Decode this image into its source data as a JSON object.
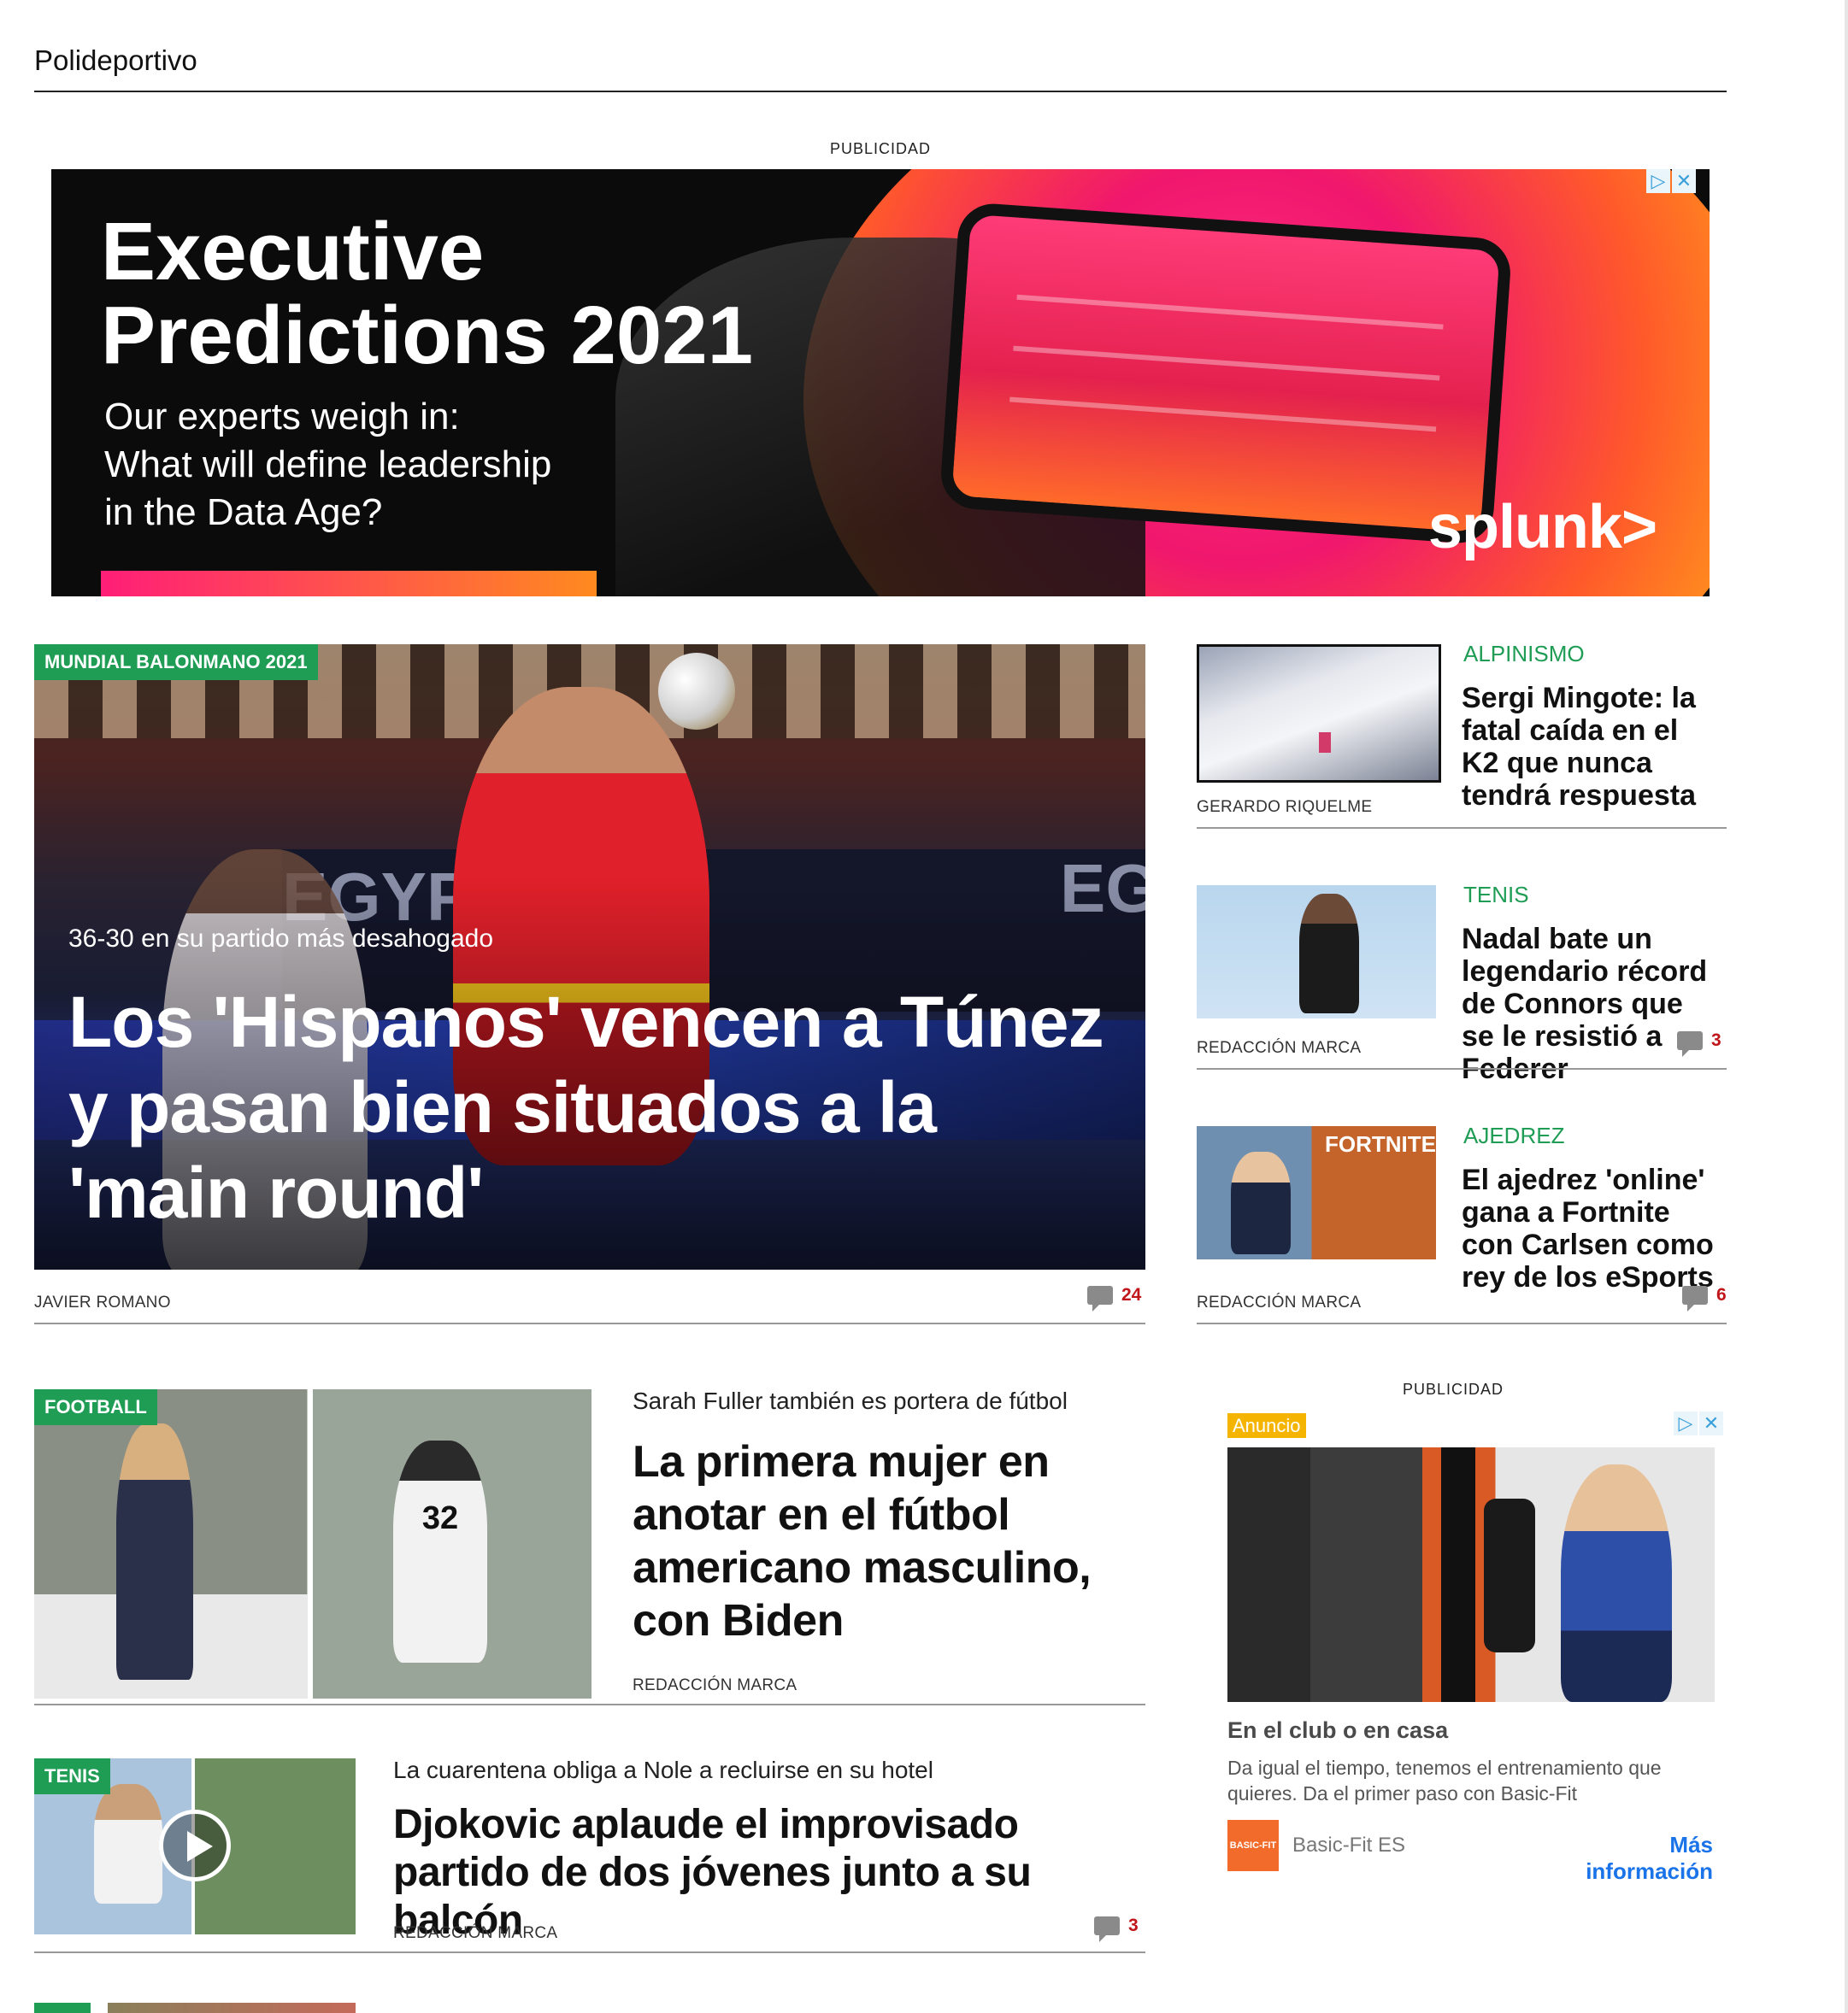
{
  "section": {
    "title": "Polideportivo"
  },
  "ads": {
    "label": "PUBLICIDAD",
    "top": {
      "headline_line1": "Executive",
      "headline_line2": "Predictions 2021",
      "sub_line1": "Our experts weigh in:",
      "sub_line2": "What will define leadership",
      "sub_line3": "in the Data Age?",
      "brand": "splunk>"
    },
    "sidebar": {
      "badge": "Anuncio",
      "title": "En el club o en casa",
      "body": "Da igual el tiempo, tenemos el entrenamiento que quieres. Da el primer paso con Basic-Fit",
      "logo_text": "BASIC-FIT",
      "source": "Basic-Fit ES",
      "cta": "Más información"
    }
  },
  "hero": {
    "tag": "MUNDIAL BALONMANO 2021",
    "kicker": "36-30 en su partido más desahogado",
    "title": "Los 'Hispanos' vencen a Túnez y pasan bien situados a la 'main round'",
    "author": "JAVIER ROMANO",
    "comments": "24",
    "photo_text_left": "EGYPT",
    "photo_text_right": "EGY"
  },
  "sidebar_stories": [
    {
      "category": "ALPINISMO",
      "title": "Sergi Mingote: la fatal caída en el K2 que nunca tendrá respuesta",
      "author": "GERARDO RIQUELME",
      "comments": ""
    },
    {
      "category": "TENIS",
      "title": "Nadal bate un legendario récord de Connors que se le resistió a Federer",
      "author": "REDACCIÓN MARCA",
      "comments": "3"
    },
    {
      "category": "AJEDREZ",
      "title": "El ajedrez 'online' gana a Fortnite con Carlsen como rey de los eSports",
      "author": "REDACCIÓN MARCA",
      "comments": "6",
      "thumb_text": "FORTNITE"
    }
  ],
  "stories": [
    {
      "tag": "FOOTBALL",
      "kicker": "Sarah Fuller también es portera de fútbol",
      "title": "La primera mujer en anotar en el fútbol americano masculino, con Biden",
      "author": "REDACCIÓN MARCA",
      "comments": "",
      "jersey": "32"
    },
    {
      "tag": "TENIS",
      "kicker": "La cuarentena obliga a Nole a recluirse en su hotel",
      "title": "Djokovic aplaude el improvisado partido de dos jóvenes junto a su balcón",
      "author": "REDACCIÓN MARCA",
      "comments": "3"
    }
  ]
}
